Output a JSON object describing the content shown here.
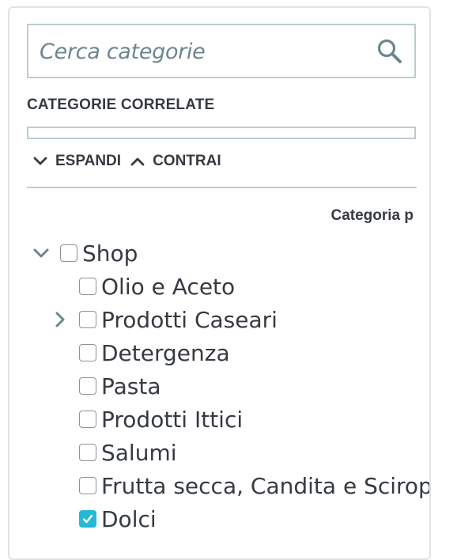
{
  "search": {
    "placeholder": "Cerca categorie",
    "icon": "search-icon"
  },
  "related": {
    "label": "CATEGORIE CORRELATE"
  },
  "tree_actions": {
    "expand_label": "ESPANDI",
    "collapse_label": "CONTRAI"
  },
  "column_header": "Categoria p",
  "tree": {
    "root": {
      "label": "Shop",
      "expanded": true,
      "checked": false
    },
    "children": [
      {
        "label": "Olio e Aceto",
        "checked": false,
        "has_children": false
      },
      {
        "label": "Prodotti Caseari",
        "checked": false,
        "has_children": true
      },
      {
        "label": "Detergenza",
        "checked": false,
        "has_children": false
      },
      {
        "label": "Pasta",
        "checked": false,
        "has_children": false
      },
      {
        "label": "Prodotti Ittici",
        "checked": false,
        "has_children": false
      },
      {
        "label": "Salumi",
        "checked": false,
        "has_children": false
      },
      {
        "label": "Frutta secca, Candita e Sciropp",
        "checked": false,
        "has_children": false
      },
      {
        "label": "Dolci",
        "checked": true,
        "has_children": false
      }
    ]
  },
  "colors": {
    "accent": "#25b9d7",
    "border": "#bbcdd2",
    "text": "#363a41",
    "placeholder": "#6c868e"
  }
}
